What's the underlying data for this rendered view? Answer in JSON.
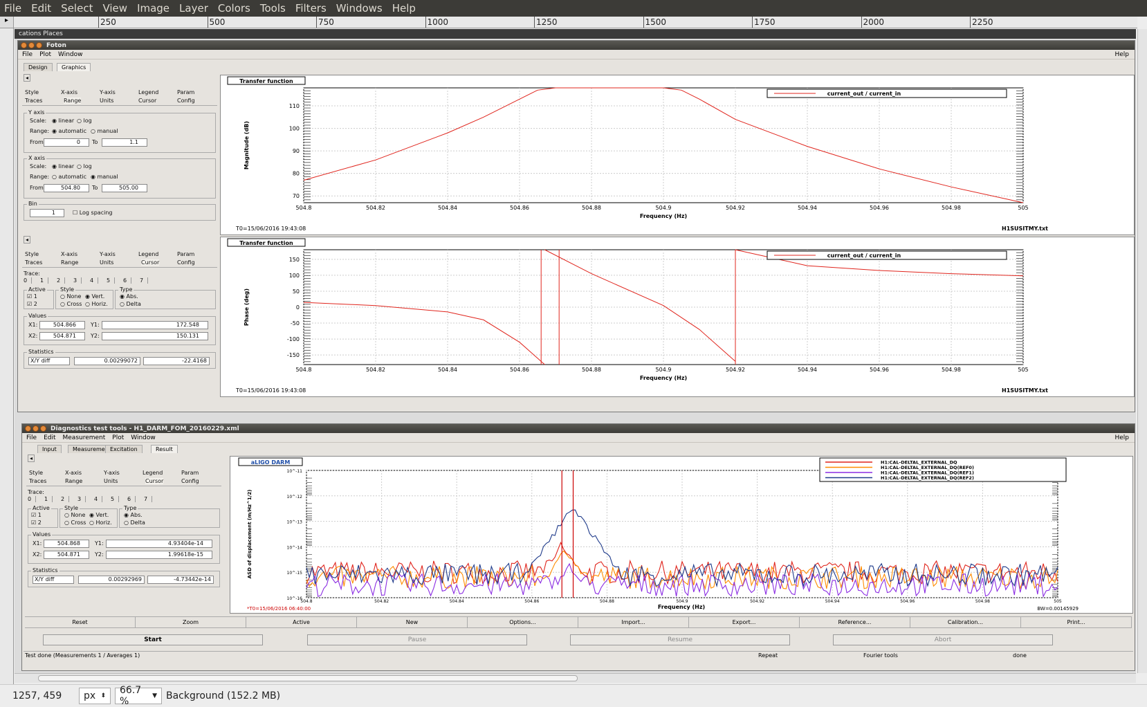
{
  "gimp": {
    "menu": [
      "File",
      "Edit",
      "Select",
      "View",
      "Image",
      "Layer",
      "Colors",
      "Tools",
      "Filters",
      "Windows",
      "Help"
    ],
    "ruler_labels": [
      "250",
      "500",
      "750",
      "1000",
      "1250",
      "1500",
      "1750",
      "2000",
      "2250"
    ],
    "status": {
      "coords": "1257, 459",
      "unit": "px",
      "zoom": "66.7 %",
      "layer": "Background (152.2 MB)"
    }
  },
  "desktop": {
    "panel_text": "cations  Places"
  },
  "foton": {
    "title": "Foton",
    "menu": [
      "File",
      "Plot",
      "Window"
    ],
    "help": "Help",
    "tabs": [
      "Design",
      "Graphics"
    ],
    "panel1": {
      "tabs_row1": [
        "Style",
        "X-axis",
        "Y-axis",
        "Legend",
        "Param"
      ],
      "tabs_row2": [
        "Traces",
        "Range",
        "Units",
        "Cursor",
        "Config"
      ],
      "yaxis": {
        "title": "Y axis",
        "scale_label": "Scale:",
        "linear": "linear",
        "log": "log",
        "range_label": "Range:",
        "automatic": "automatic",
        "manual": "manual",
        "from_label": "From",
        "from": "0",
        "to_label": "To",
        "to": "1.1"
      },
      "xaxis": {
        "title": "X axis",
        "scale_label": "Scale:",
        "linear": "linear",
        "log": "log",
        "range_label": "Range:",
        "automatic": "automatic",
        "manual": "manual",
        "from_label": "From",
        "from": "504.80",
        "to_label": "To",
        "to": "505.00"
      },
      "bin": {
        "title": "Bin",
        "value": "1",
        "log_spacing": "Log spacing"
      }
    },
    "panel2": {
      "tabs_row1": [
        "Style",
        "X-axis",
        "Y-axis",
        "Legend",
        "Param"
      ],
      "tabs_row2": [
        "Traces",
        "Range",
        "Units",
        "Cursor",
        "Config"
      ],
      "trace_label": "Trace:",
      "traces": [
        "0",
        "1",
        "2",
        "3",
        "4",
        "5",
        "6",
        "7"
      ],
      "active_title": "Active",
      "active": [
        "1",
        "2"
      ],
      "style_title": "Style",
      "style_opts": [
        "None",
        "Vert.",
        "Cross",
        "Horiz."
      ],
      "type_title": "Type",
      "type_opts": [
        "Abs.",
        "Delta"
      ],
      "values_title": "Values",
      "x1_label": "X1:",
      "x1": "504.866",
      "y1_label": "Y1:",
      "y1": "172.548",
      "x2_label": "X2:",
      "x2": "504.871",
      "y2_label": "Y2:",
      "y2": "150.131",
      "stats_title": "Statistics",
      "stats_mode": "X/Y diff",
      "stat_x": "0.00299072",
      "stat_y": "-22.4168"
    },
    "plot1": {
      "title": "Transfer function",
      "ylabel": "Magnitude (dB)",
      "xlabel": "Frequency (Hz)",
      "t0": "T0=15/06/2016 19:43:08",
      "file": "H1SUSITMY.txt",
      "legend": "current_out / current_in"
    },
    "plot2": {
      "title": "Transfer function",
      "ylabel": "Phase (deg)",
      "xlabel": "Frequency (Hz)",
      "t0": "T0=15/06/2016 19:43:08",
      "file": "H1SUSITMY.txt",
      "legend": "current_out / current_in"
    }
  },
  "dtt": {
    "title": "Diagnostics test tools - H1_DARM_FOM_20160229.xml",
    "menu": [
      "File",
      "Edit",
      "Measurement",
      "Plot",
      "Window"
    ],
    "help": "Help",
    "tabs": [
      "Input",
      "Measurement",
      "Excitation",
      "Result"
    ],
    "panel": {
      "tabs_row1": [
        "Style",
        "X-axis",
        "Y-axis",
        "Legend",
        "Param"
      ],
      "tabs_row2": [
        "Traces",
        "Range",
        "Units",
        "Cursor",
        "Config"
      ],
      "trace_label": "Trace:",
      "traces": [
        "0",
        "1",
        "2",
        "3",
        "4",
        "5",
        "6",
        "7"
      ],
      "active_title": "Active",
      "active": [
        "1",
        "2"
      ],
      "style_title": "Style",
      "style_opts": [
        "None",
        "Vert.",
        "Cross",
        "Horiz."
      ],
      "type_title": "Type",
      "type_opts": [
        "Abs.",
        "Delta"
      ],
      "values_title": "Values",
      "x1_label": "X1:",
      "x1": "504.868",
      "y1_label": "Y1:",
      "y1": "4.93404e-14",
      "x2_label": "X2:",
      "x2": "504.871",
      "y2_label": "Y2:",
      "y2": "1.99618e-15",
      "stats_title": "Statistics",
      "stats_mode": "X/Y diff",
      "stat_x": "0.00292969",
      "stat_y": "-4.73442e-14"
    },
    "plot": {
      "title": "aLIGO DARM",
      "ylabel": "ASD of displacement (m/Hz^1/2)",
      "xlabel": "Frequency (Hz)",
      "t0": "*T0=15/06/2016 06:40:00",
      "bw": "BW=0.00145929",
      "legend": [
        "H1:CAL-DELTAL_EXTERNAL_DQ",
        "H1:CAL-DELTAL_EXTERNAL_DQ(REF0)",
        "H1:CAL-DELTAL_EXTERNAL_DQ(REF1)",
        "H1:CAL-DELTAL_EXTERNAL_DQ(REF2)"
      ],
      "legend_colors": [
        "#e0241c",
        "#ff8c00",
        "#8a2be2",
        "#1e3a8a"
      ]
    },
    "buttons": [
      "Reset",
      "Zoom",
      "Active",
      "New",
      "Options...",
      "Import...",
      "Export...",
      "Reference...",
      "Calibration...",
      "Print..."
    ],
    "start": "Start",
    "pause": "Pause",
    "resume": "Resume",
    "abort": "Abort",
    "status": {
      "msg": "Test done (Measurements 1 / Averages 1)",
      "repeat": "Repeat",
      "tools": "Fourier tools",
      "done": "done"
    }
  },
  "chart_data": [
    {
      "type": "line",
      "title": "Transfer function",
      "xlabel": "Frequency (Hz)",
      "ylabel": "Magnitude (dB)",
      "xlim": [
        504.8,
        505.0
      ],
      "ylim": [
        67,
        118
      ],
      "x_ticks": [
        "504.8",
        "504.82",
        "504.84",
        "504.86",
        "504.88",
        "504.9",
        "504.92",
        "504.94",
        "504.96",
        "504.98",
        "505"
      ],
      "y_ticks": [
        "70",
        "80",
        "90",
        "100",
        "110"
      ],
      "series": [
        {
          "name": "current_out / current_in",
          "color": "#e0241c",
          "x": [
            504.8,
            504.82,
            504.84,
            504.85,
            504.86,
            504.865,
            504.87,
            504.89,
            504.9,
            504.905,
            504.91,
            504.92,
            504.94,
            504.96,
            504.98,
            505.0
          ],
          "y": [
            77,
            86,
            98,
            105,
            113,
            117,
            118,
            118,
            118,
            117,
            113,
            104,
            92,
            82,
            74,
            67
          ]
        }
      ]
    },
    {
      "type": "line",
      "title": "Transfer function",
      "xlabel": "Frequency (Hz)",
      "ylabel": "Phase (deg)",
      "xlim": [
        504.8,
        505.0
      ],
      "ylim": [
        -180,
        180
      ],
      "x_ticks": [
        "504.8",
        "504.82",
        "504.84",
        "504.86",
        "504.88",
        "504.9",
        "504.92",
        "504.94",
        "504.96",
        "504.98",
        "505"
      ],
      "y_ticks": [
        "150",
        "100",
        "50",
        "0",
        "-50",
        "-100",
        "-150"
      ],
      "series": [
        {
          "name": "current_out / current_in",
          "color": "#e0241c",
          "x": [
            504.8,
            504.82,
            504.84,
            504.85,
            504.86,
            504.867,
            504.867,
            504.88,
            504.9,
            504.91,
            504.92,
            504.92,
            504.94,
            504.96,
            504.98,
            505.0
          ],
          "y": [
            15,
            5,
            -15,
            -40,
            -110,
            -180,
            180,
            105,
            5,
            -70,
            -170,
            180,
            130,
            115,
            105,
            98
          ]
        }
      ],
      "cursors_x": [
        504.866,
        504.871,
        504.92
      ]
    },
    {
      "type": "line",
      "title": "aLIGO DARM",
      "xlabel": "Frequency (Hz)",
      "ylabel": "ASD of displacement (m/Hz^1/2)",
      "xlim": [
        504.8,
        505.0
      ],
      "x_ticks": [
        "504.8",
        "504.82",
        "504.84",
        "504.86",
        "504.88",
        "504.9",
        "504.92",
        "504.94",
        "504.96",
        "504.98",
        "505"
      ],
      "y_ticks": [
        "10^-11",
        "10^-12",
        "10^-13",
        "10^-14",
        "10^-15",
        "10^-16"
      ],
      "ylim": [
        -16,
        -11
      ],
      "y_log": true,
      "series": [
        {
          "name": "H1:CAL-DELTAL_EXTERNAL_DQ",
          "color": "#e0241c",
          "peak": [
            504.868,
            -13.9
          ],
          "floor": -15.0
        },
        {
          "name": "H1:CAL-DELTAL_EXTERNAL_DQ(REF0)",
          "color": "#ff8c00",
          "peak": [
            504.869,
            -14.1
          ],
          "floor": -15.2
        },
        {
          "name": "H1:CAL-DELTAL_EXTERNAL_DQ(REF1)",
          "color": "#8a2be2",
          "peak": [
            504.87,
            -14.7
          ],
          "floor": -15.5
        },
        {
          "name": "H1:CAL-DELTAL_EXTERNAL_DQ(REF2)",
          "color": "#1e3a8a",
          "peak": [
            504.871,
            -12.4
          ],
          "floor": -15.1
        }
      ],
      "cursors_x": [
        504.868,
        504.871
      ]
    }
  ]
}
